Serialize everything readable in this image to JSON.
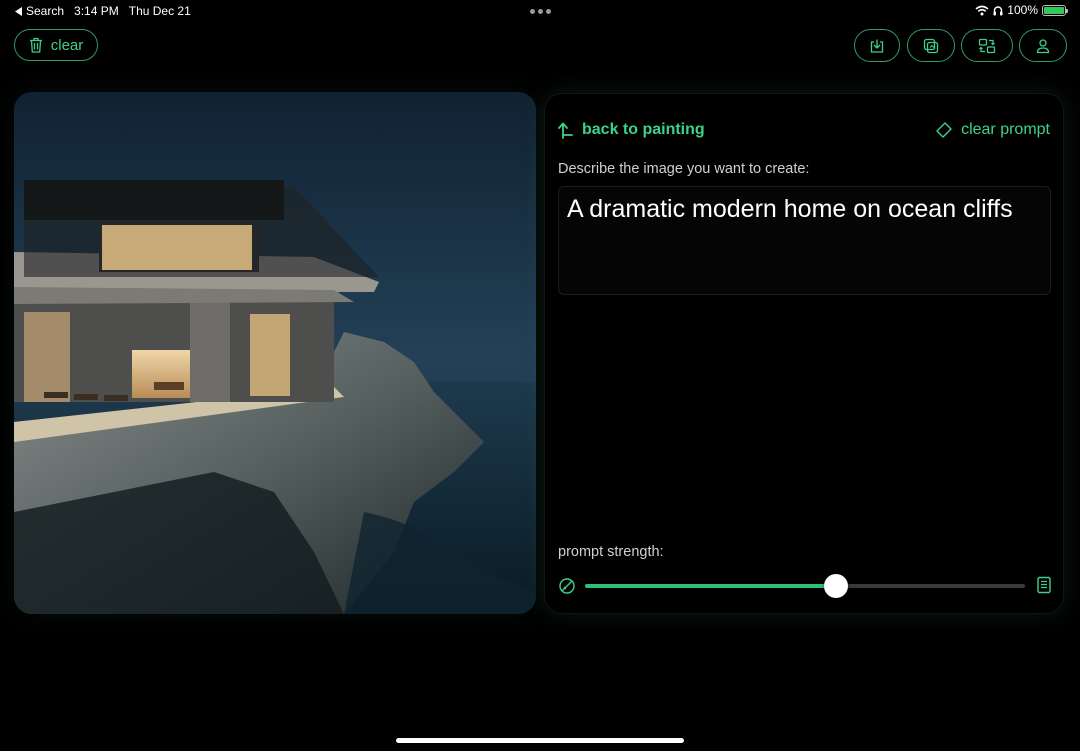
{
  "status_bar": {
    "back_label": "Search",
    "time": "3:14 PM",
    "date": "Thu Dec 21",
    "battery": "100%"
  },
  "toolbar": {
    "clear_label": "clear"
  },
  "prompt": {
    "back_label": "back to painting",
    "clear_label": "clear prompt",
    "describe_label": "Describe the image you want to create:",
    "text": "A dramatic modern home on ocean cliffs",
    "strength_label": "prompt strength:",
    "strength_value": 0.57
  },
  "colors": {
    "accent": "#3fd189",
    "background": "#000000"
  }
}
